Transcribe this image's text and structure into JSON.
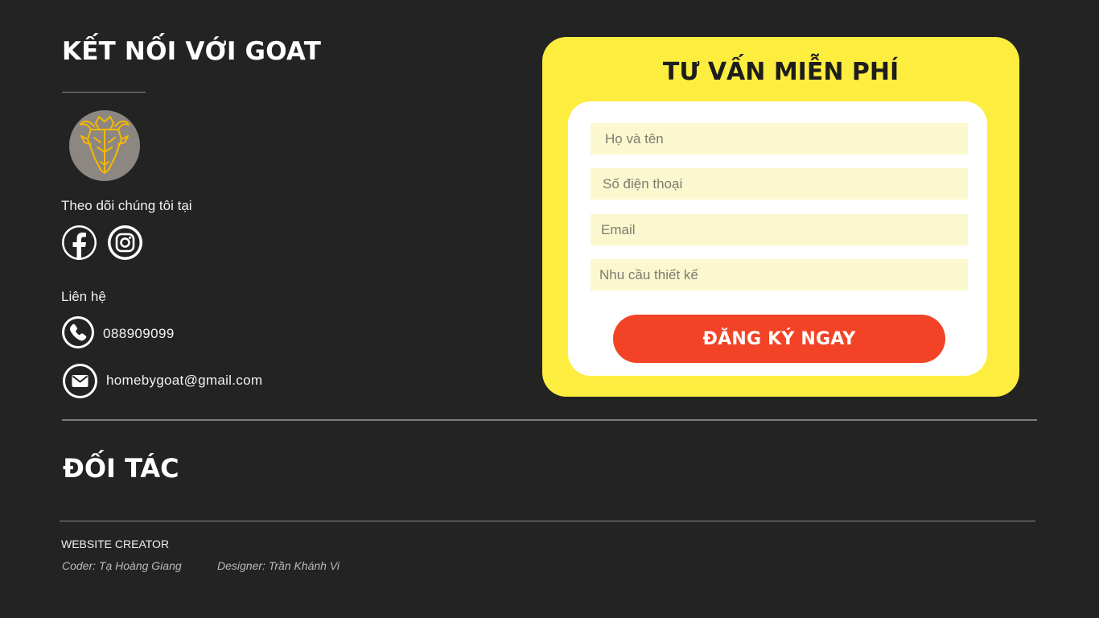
{
  "contact_section": {
    "title": "KẾT NỐI VỚI GOAT",
    "logo_icon": "goat-head-logo",
    "follow_label": "Theo dõi chúng tôi tại",
    "social": [
      {
        "icon": "facebook-icon"
      },
      {
        "icon": "instagram-icon"
      }
    ],
    "contact_label": "Liên hệ",
    "phone": "088909099",
    "email": "homebygoat@gmail.com"
  },
  "form": {
    "title": "TƯ VẤN MIỄN PHÍ",
    "name_placeholder": "Họ và tên",
    "phone_placeholder": "Số điện thoại",
    "email_placeholder": "Email",
    "need_placeholder": "Nhu cầu thiết kế",
    "submit_label": "ĐĂNG KÝ NGAY"
  },
  "partners": {
    "title": "ĐỐI TÁC"
  },
  "footer": {
    "creator_label": "WEBSITE CREATOR",
    "coder": "Coder: Tạ Hoàng Giang",
    "designer": "Designer: Trần Khánh Vi"
  },
  "colors": {
    "background": "#232323",
    "card": "#fded3f",
    "input": "#fbf8cf",
    "button": "#f24326",
    "logo_accent": "#f5b800"
  }
}
